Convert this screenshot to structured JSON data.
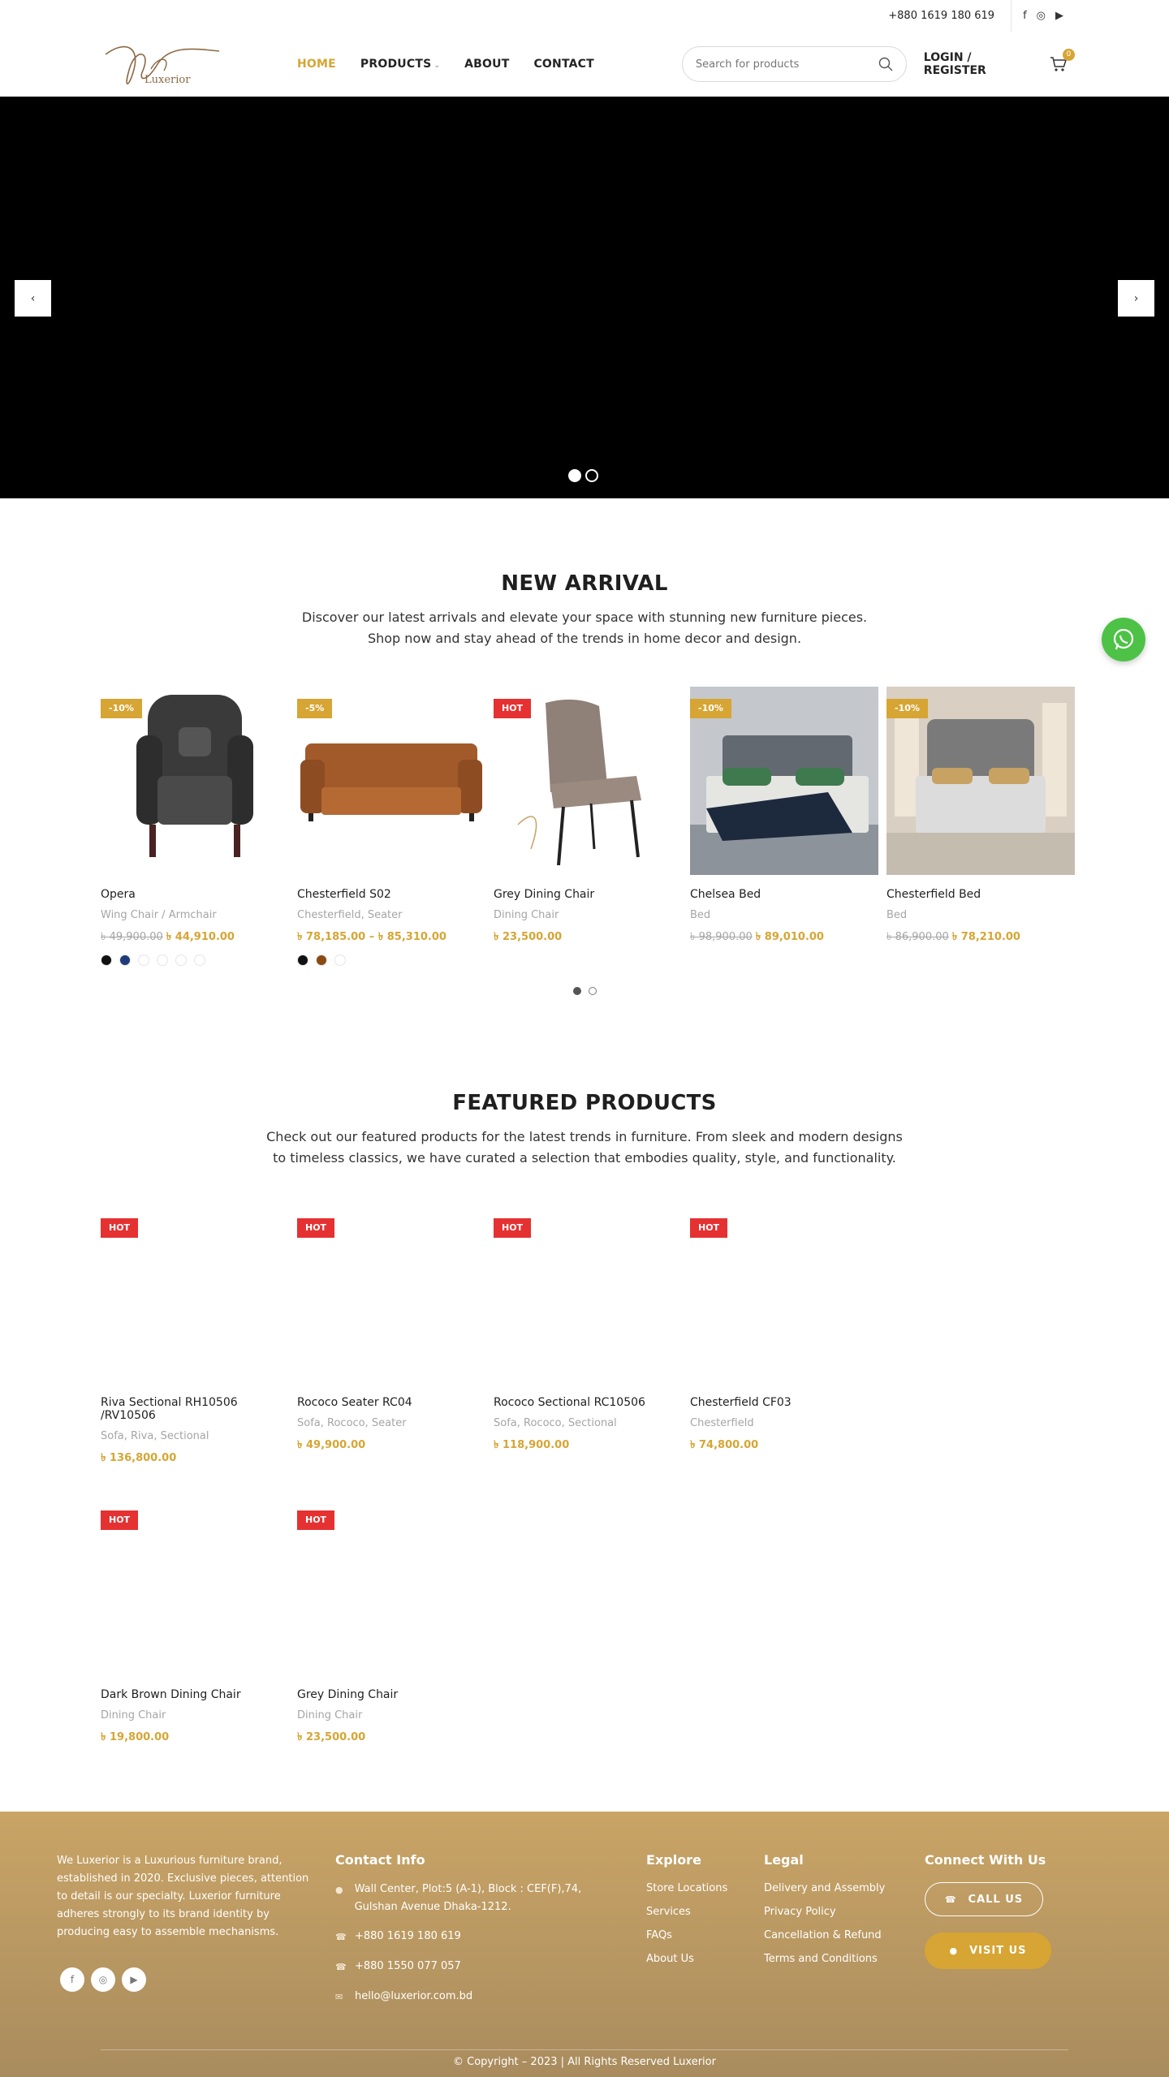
{
  "topbar": {
    "phone": "+880 1619 180 619",
    "social": [
      "facebook-icon",
      "instagram-icon",
      "youtube-icon"
    ]
  },
  "brand": {
    "logo_text": "Luxerior"
  },
  "nav": [
    {
      "label": "HOME",
      "active": true
    },
    {
      "label": "PRODUCTS",
      "dropdown": true
    },
    {
      "label": "ABOUT"
    },
    {
      "label": "CONTACT"
    }
  ],
  "search": {
    "placeholder": "Search for products"
  },
  "header": {
    "login_label": "LOGIN / REGISTER",
    "cart_count": "0"
  },
  "hero": {
    "slides": 2,
    "active_slide": 1
  },
  "new_arrival": {
    "title": "NEW ARRIVAL",
    "desc_line1": "Discover our latest arrivals and elevate your space with stunning new furniture pieces.",
    "desc_line2": "Shop now and stay ahead of the trends in home decor and design.",
    "products": [
      {
        "badge": "-10%",
        "name": "Opera",
        "cats": "Wing Chair / Armchair",
        "old": "৳ 49,900.00",
        "price": "৳ 44,910.00"
      },
      {
        "badge": "-5%",
        "name": "Chesterfield S02",
        "cats": "Chesterfield, Seater",
        "old": "",
        "price": "৳ 78,185.00 – ৳ 85,310.00"
      },
      {
        "badge": "HOT",
        "name": "Grey Dining Chair",
        "cats": "Dining Chair",
        "old": "",
        "price": "৳ 23,500.00"
      },
      {
        "badge": "-10%",
        "name": "Chelsea Bed",
        "cats": "Bed",
        "old": "৳ 98,900.00",
        "price": "৳ 89,010.00"
      },
      {
        "badge": "-10%",
        "name": "Chesterfield Bed",
        "cats": "Bed",
        "old": "৳ 86,900.00",
        "price": "৳ 78,210.00"
      }
    ],
    "pages": 2
  },
  "featured": {
    "title": "FEATURED PRODUCTS",
    "desc_line1": "Check out our featured products for the latest trends in furniture. From sleek and modern designs",
    "desc_line2": "to timeless classics, we have curated a selection that embodies quality, style, and functionality.",
    "products": [
      {
        "badge": "HOT",
        "name": "Riva Sectional RH10506 /RV10506",
        "cats": "Sofa, Riva, Sectional",
        "price": "৳ 136,800.00"
      },
      {
        "badge": "HOT",
        "name": "Rococo Seater RC04",
        "cats": "Sofa, Rococo, Seater",
        "price": "৳ 49,900.00"
      },
      {
        "badge": "HOT",
        "name": "Rococo Sectional RC10506",
        "cats": "Sofa, Rococo, Sectional",
        "price": "৳ 118,900.00"
      },
      {
        "badge": "HOT",
        "name": "Chesterfield CF03",
        "cats": "Chesterfield",
        "price": "৳ 74,800.00"
      },
      {
        "badge": "HOT",
        "name": "Dark Brown Dining Chair",
        "cats": "Dining Chair",
        "price": "৳ 19,800.00"
      },
      {
        "badge": "HOT",
        "name": "Grey Dining Chair",
        "cats": "Dining Chair",
        "price": "৳ 23,500.00"
      }
    ]
  },
  "footer": {
    "about": "We Luxerior is a Luxurious furniture brand, established in 2020. Exclusive pieces, attention to detail is our specialty. Luxerior furniture adheres strongly to its brand identity by producing easy to assemble mechanisms.",
    "contact_title": "Contact Info",
    "address": "Wall Center, Plot:5 (A-1), Block : CEF(F),74, Gulshan Avenue Dhaka-1212.",
    "phone1": "+880 1619 180 619",
    "phone2": "+880 1550 077 057",
    "email": "hello@luxerior.com.bd",
    "explore_title": "Explore",
    "explore": [
      "Store Locations",
      "Services",
      "FAQs",
      "About Us"
    ],
    "legal_title": "Legal",
    "legal": [
      "Delivery and Assembly",
      "Privacy Policy",
      "Cancellation & Refund",
      "Terms and Conditions"
    ],
    "connect_title": "Connect With Us",
    "call_label": "CALL US",
    "visit_label": "VISIT US",
    "copyright": "© Copyright – 2023 | All Rights Reserved Luxerior"
  },
  "colors": {
    "accent": "#d6a534",
    "hot": "#e53131",
    "footer_top": "#c9a466",
    "footer_bottom": "#a98c5e",
    "whatsapp": "#4dc247"
  }
}
